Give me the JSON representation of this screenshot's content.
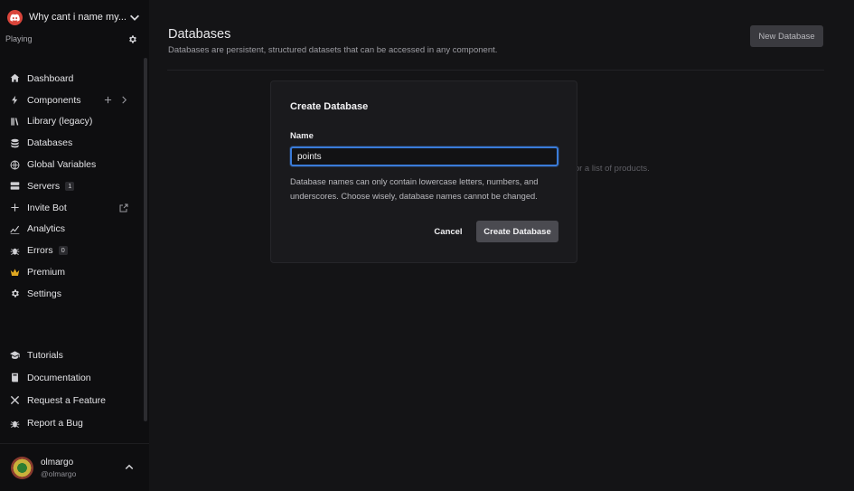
{
  "bot": {
    "name": "Why cant i name my...",
    "status": "Playing",
    "avatar_color": "#d9453b"
  },
  "sidebar": {
    "items": [
      {
        "label": "Dashboard",
        "icon": "home-icon"
      },
      {
        "label": "Components",
        "icon": "bolt-icon"
      },
      {
        "label": "Library (legacy)",
        "icon": "library-icon"
      },
      {
        "label": "Databases",
        "icon": "database-icon"
      },
      {
        "label": "Global Variables",
        "icon": "globe-icon"
      },
      {
        "label": "Servers",
        "icon": "server-icon",
        "badge": "1"
      },
      {
        "label": "Invite Bot",
        "icon": "plus-icon"
      },
      {
        "label": "Analytics",
        "icon": "chart-icon"
      },
      {
        "label": "Errors",
        "icon": "bug-icon",
        "badge": "0"
      },
      {
        "label": "Premium",
        "icon": "crown-icon"
      },
      {
        "label": "Settings",
        "icon": "gear-icon"
      }
    ],
    "secondary": [
      {
        "label": "Tutorials",
        "icon": "graduation-cap-icon"
      },
      {
        "label": "Documentation",
        "icon": "book-icon"
      },
      {
        "label": "Request a Feature",
        "icon": "tools-icon"
      },
      {
        "label": "Report a Bug",
        "icon": "bug-icon"
      }
    ]
  },
  "user": {
    "name": "olmargo",
    "handle": "@olmargo"
  },
  "page": {
    "title": "Databases",
    "subtitle": "Databases are persistent, structured datasets that can be accessed in any component.",
    "new_button": "New Database",
    "empty_text_peek": "ers or a list of products."
  },
  "modal": {
    "title": "Create Database",
    "field_label": "Name",
    "field_value": "points",
    "hint": "Database names can only contain lowercase letters, numbers, and underscores. Choose wisely, database names cannot be changed.",
    "cancel_label": "Cancel",
    "create_label": "Create Database",
    "focus_color": "#3a7bd8"
  }
}
